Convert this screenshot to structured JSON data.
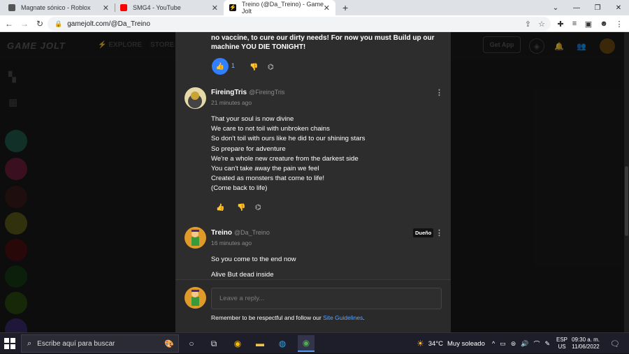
{
  "browser": {
    "tabs": [
      {
        "title": "Magnate sónico - Roblox",
        "icon": "roblox-icon"
      },
      {
        "title": "SMG4 - YouTube",
        "icon": "youtube-icon"
      },
      {
        "title": "Treino (@Da_Treino) - Game Jolt",
        "icon": "gamejolt-icon"
      }
    ],
    "new_tab_label": "+",
    "url": "gamejolt.com/@Da_Treino"
  },
  "site": {
    "logo": "GAME JOLT",
    "nav": {
      "explore": "EXPLORE",
      "store": "STORE"
    },
    "get_app": "Get App"
  },
  "thread": {
    "prev_comment_text": "no vaccine, to cure our dirty needs! For now you must Build up our machine YOU DIE TONIGHT!",
    "prev_like_count": "1",
    "comments": [
      {
        "name": "FireingTris",
        "handle": "@FireingTris",
        "time": "21 minutes ago",
        "lines": [
          "That your soul is now divine",
          "We care to not toil with unbroken chains",
          "So don't toil with ours like he did to our shining stars",
          "So prepare for adventure",
          "We're a whole new creature from the darkest side",
          "You can't take away the pain we feel",
          "Created as monsters that come to life!",
          "(Come back to life)"
        ]
      },
      {
        "name": "Treino",
        "handle": "@Da_Treino",
        "time": "16 minutes ago",
        "badge": "Dueño",
        "lines": [
          "So you come to the end now",
          "Alive But dead inside"
        ]
      }
    ],
    "reply": {
      "placeholder": "Leave a reply...",
      "note_prefix": "Remember to be respectful and follow our ",
      "note_link": "Site Guidelines",
      "note_suffix": "."
    }
  },
  "taskbar": {
    "search_placeholder": "Escribe aquí para buscar",
    "weather_temp": "34°C",
    "weather_text": "Muy soleado",
    "lang_line1": "ESP",
    "lang_line2": "US",
    "time": "09:30 a. m.",
    "date": "11/06/2022"
  },
  "colors": {
    "accent": "#2f7ffe",
    "link": "#5aa6ff",
    "panel": "#2d2d2d"
  }
}
